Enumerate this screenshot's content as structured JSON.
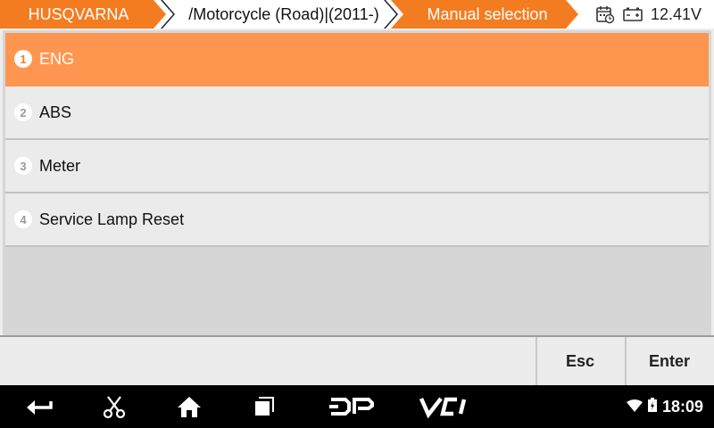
{
  "header": {
    "breadcrumbs": [
      "HUSQVARNA",
      "/Motorcycle (Road)|(2011-)",
      "Manual selection"
    ],
    "icons": [
      "calendar-clock-icon",
      "battery-icon"
    ],
    "voltage": "12.41V",
    "accent_color": "#f47c20"
  },
  "list": {
    "items": [
      {
        "num": "1",
        "label": "ENG"
      },
      {
        "num": "2",
        "label": "ABS"
      },
      {
        "num": "3",
        "label": "Meter"
      },
      {
        "num": "4",
        "label": "Service Lamp Reset"
      }
    ],
    "selected_index": 0
  },
  "toolbar": {
    "esc_label": "Esc",
    "enter_label": "Enter"
  },
  "navbar": {
    "icons": [
      "back-icon",
      "scissors-icon",
      "home-icon",
      "recent-apps-icon",
      "dp-icon",
      "vci-icon"
    ],
    "dp_label": "DP",
    "vci_label": "VCI",
    "time": "18:09"
  }
}
